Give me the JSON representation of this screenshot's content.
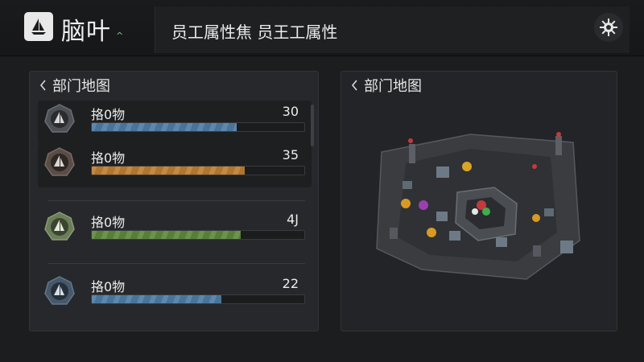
{
  "app": {
    "title": "脑叶"
  },
  "header": {
    "text": "员工属性焦 员王工属性"
  },
  "left_panel": {
    "title": "部门地图",
    "items": [
      {
        "label": "挌0物",
        "value": "30",
        "fill": 0.68,
        "color": "#4f7ea6"
      },
      {
        "label": "挌0物",
        "value": "35",
        "fill": 0.72,
        "color": "#c07f32"
      },
      {
        "label": "挌0物",
        "value": "4J",
        "fill": 0.7,
        "color": "#5f8a3e"
      },
      {
        "label": "挌0物",
        "value": "22",
        "fill": 0.61,
        "color": "#4f7ea6"
      }
    ]
  },
  "right_panel": {
    "title": "部门地图"
  },
  "icons": {
    "logo": "sailboat-icon",
    "settings": "gear-icon",
    "back": "chevron-left-icon"
  }
}
